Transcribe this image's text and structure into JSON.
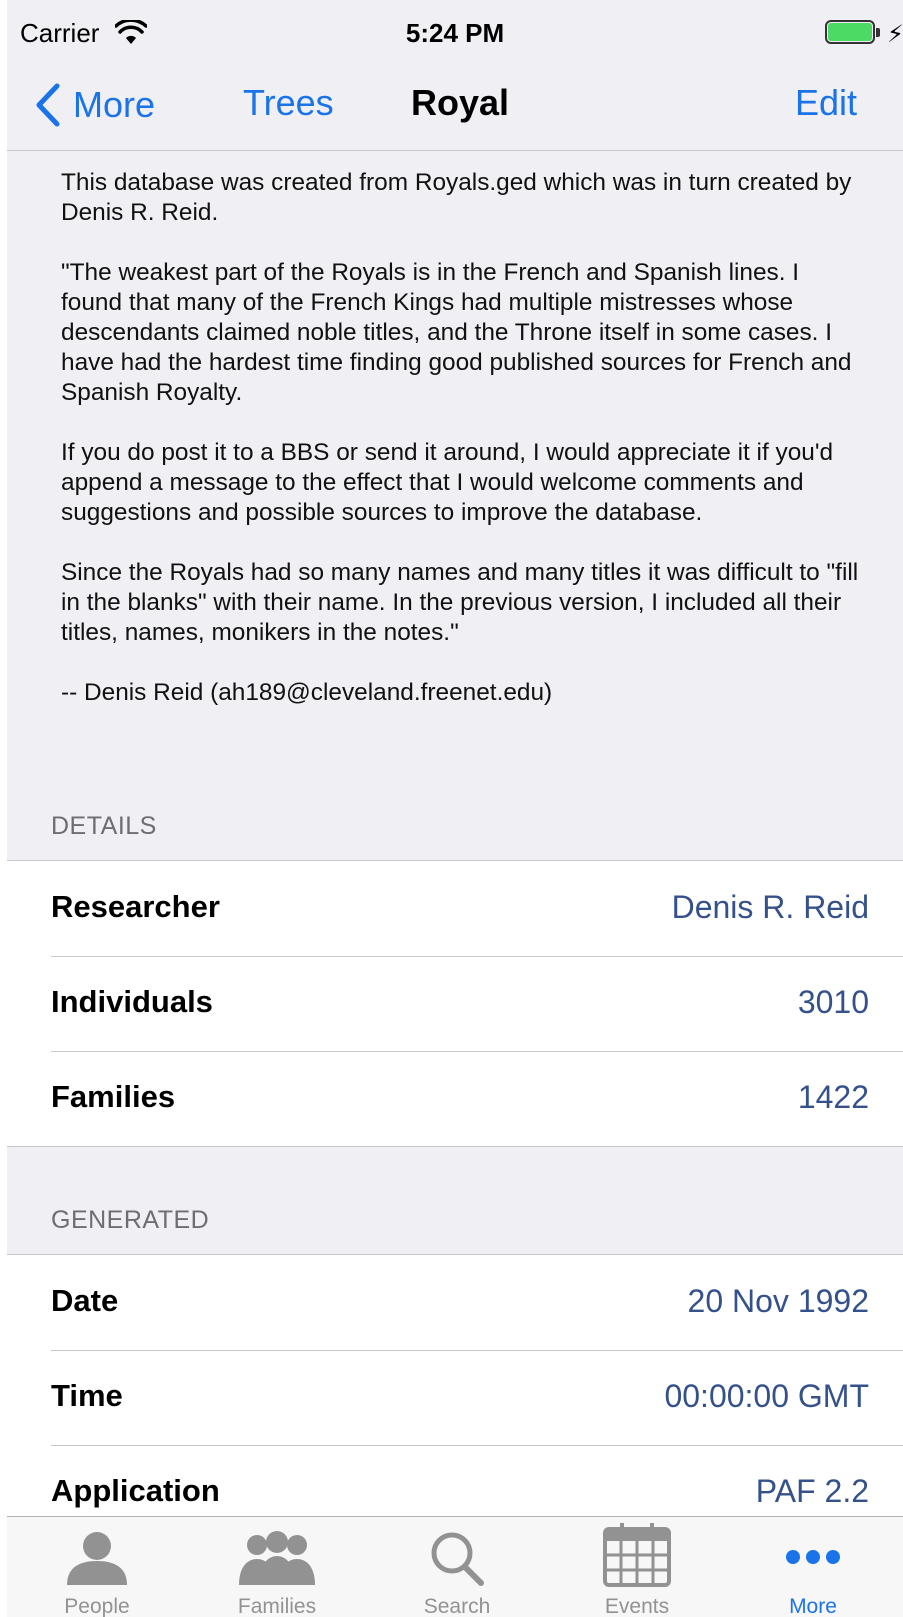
{
  "status_bar": {
    "carrier": "Carrier",
    "time": "5:24 PM"
  },
  "nav": {
    "back_label": "More",
    "trees_label": "Trees",
    "title": "Royal",
    "edit_label": "Edit"
  },
  "notes": [
    "This database was created from Royals.ged which was in turn created by Denis R. Reid.",
    "\"The weakest part of the Royals is in the French and Spanish lines. I found that many of the French Kings had multiple mistresses whose descendants claimed noble titles, and the Throne itself in some cases.  I have had the hardest time finding good published sources for French and Spanish Royalty.",
    "If you do post it to a BBS or send it around, I would appreciate it if you'd append a message to the effect that I would welcome comments and suggestions and possible sources to improve the database.",
    "Since the Royals had so many names and many titles it was difficult to \"fill in the blanks\" with their name.  In the previous version, I included all their titles, names, monikers in the notes.\"",
    "--  Denis Reid (ah189@cleveland.freenet.edu)"
  ],
  "details": {
    "header": "DETAILS",
    "rows": [
      {
        "label": "Researcher",
        "value": "Denis R. Reid"
      },
      {
        "label": "Individuals",
        "value": "3010"
      },
      {
        "label": "Families",
        "value": "1422"
      }
    ]
  },
  "generated": {
    "header": "GENERATED",
    "rows": [
      {
        "label": "Date",
        "value": "20 Nov 1992"
      },
      {
        "label": "Time",
        "value": "00:00:00 GMT"
      },
      {
        "label": "Application",
        "value": "PAF 2.2"
      }
    ]
  },
  "tabs": [
    {
      "label": "People",
      "icon": "person-icon"
    },
    {
      "label": "Families",
      "icon": "family-icon"
    },
    {
      "label": "Search",
      "icon": "search-icon"
    },
    {
      "label": "Events",
      "icon": "calendar-icon"
    },
    {
      "label": "More",
      "icon": "more-icon",
      "active": true
    }
  ],
  "colors": {
    "accent": "#1a73e8",
    "value_text": "#34518c",
    "battery": "#4cd964",
    "background": "#efeff4"
  }
}
